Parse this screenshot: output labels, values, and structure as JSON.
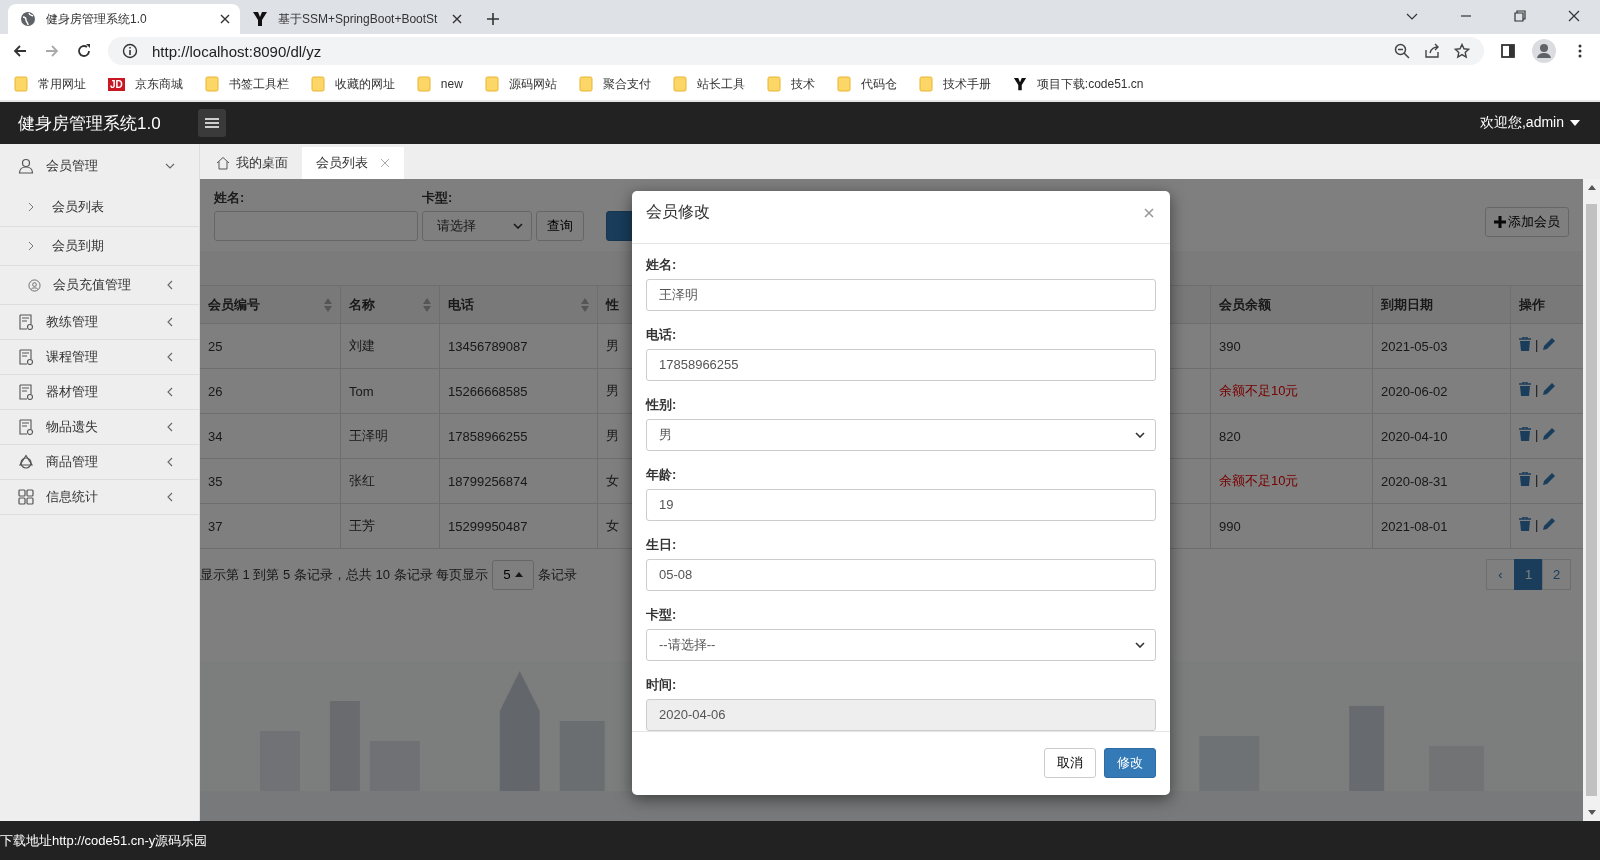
{
  "browser": {
    "tabs": [
      {
        "title": "健身房管理系统1.0",
        "selected": true
      },
      {
        "title": "基于SSM+SpringBoot+BootSt",
        "selected": false
      }
    ],
    "url": "http://localhost:8090/dl/yz",
    "bookmarks": [
      {
        "label": "常用网址",
        "kind": "folder"
      },
      {
        "label": "京东商城",
        "kind": "badge",
        "badge": "JD"
      },
      {
        "label": "书签工具栏",
        "kind": "folder"
      },
      {
        "label": "收藏的网址",
        "kind": "folder"
      },
      {
        "label": "new",
        "kind": "folder"
      },
      {
        "label": "源码网站",
        "kind": "folder"
      },
      {
        "label": "聚合支付",
        "kind": "folder"
      },
      {
        "label": "站长工具",
        "kind": "folder"
      },
      {
        "label": "技术",
        "kind": "folder"
      },
      {
        "label": "代码仓",
        "kind": "folder"
      },
      {
        "label": "技术手册",
        "kind": "folder"
      },
      {
        "label": "项目下载:code51.cn",
        "kind": "logo"
      }
    ]
  },
  "app": {
    "title": "健身房管理系统1.0",
    "user": "欢迎您,admin"
  },
  "sidebar": {
    "items": [
      {
        "label": "会员管理",
        "expanded": true,
        "children": [
          {
            "label": "会员列表",
            "kind": "link"
          },
          {
            "label": "会员到期",
            "kind": "link"
          },
          {
            "label": "会员充值管理",
            "kind": "group",
            "expanded": false
          }
        ]
      },
      {
        "label": "教练管理",
        "expanded": false
      },
      {
        "label": "课程管理",
        "expanded": false
      },
      {
        "label": "器材管理",
        "expanded": false
      },
      {
        "label": "物品遗失",
        "expanded": false
      },
      {
        "label": "商品管理",
        "expanded": false
      },
      {
        "label": "信息统计",
        "expanded": false
      }
    ]
  },
  "page_tabs": [
    {
      "label": "我的桌面",
      "selected": false,
      "closable": false
    },
    {
      "label": "会员列表",
      "selected": true,
      "closable": true
    }
  ],
  "search": {
    "name_label": "姓名:",
    "card_label": "卡型:",
    "card_value": "请选择",
    "query_button": "查询",
    "add_button": "添加会员"
  },
  "table": {
    "columns": [
      {
        "label": "会员编号",
        "sortable": true
      },
      {
        "label": "名称",
        "sortable": true
      },
      {
        "label": "电话",
        "sortable": true
      },
      {
        "label": "性",
        "sortable": false
      },
      {
        "label": "会员余额",
        "sortable": false
      },
      {
        "label": "到期日期",
        "sortable": false
      },
      {
        "label": "操作",
        "sortable": false
      }
    ],
    "rows": [
      {
        "cells": [
          "25",
          "刘建",
          "13456789087",
          "男",
          "390",
          "2021-05-03"
        ],
        "low_balance": false,
        "separator": "|"
      },
      {
        "cells": [
          "26",
          "Tom",
          "15266668585",
          "男",
          "余额不足10元",
          "2020-06-02"
        ],
        "low_balance": true,
        "separator": "|"
      },
      {
        "cells": [
          "34",
          "王泽明",
          "17858966255",
          "男",
          "820",
          "2020-04-10"
        ],
        "low_balance": false,
        "separator": "|"
      },
      {
        "cells": [
          "35",
          "张红",
          "18799256874",
          "女",
          "余额不足10元",
          "2020-08-31"
        ],
        "low_balance": true,
        "separator": "|"
      },
      {
        "cells": [
          "37",
          "王芳",
          "15299950487",
          "女",
          "990",
          "2021-08-01"
        ],
        "low_balance": false,
        "separator": "|"
      }
    ]
  },
  "pagination": {
    "info": "显示第 1 到第 5 条记录，总共 10 条记录 每页显示",
    "page_size": "5",
    "suffix": "条记录",
    "prev": "‹",
    "pages": [
      {
        "label": "1",
        "selected": true
      },
      {
        "label": "2",
        "selected": false
      }
    ]
  },
  "modal": {
    "title": "会员修改",
    "fields": [
      {
        "label": "姓名:",
        "kind": "input",
        "value": "王泽明"
      },
      {
        "label": "电话:",
        "kind": "input",
        "value": "17858966255"
      },
      {
        "label": "性别:",
        "kind": "select",
        "value": "男"
      },
      {
        "label": "年龄:",
        "kind": "input",
        "value": "19"
      },
      {
        "label": "生日:",
        "kind": "input",
        "value": "05-08"
      },
      {
        "label": "卡型:",
        "kind": "select",
        "value": "--请选择--"
      },
      {
        "label": "时间:",
        "kind": "readonly",
        "value": "2020-04-06"
      }
    ],
    "buttons": [
      {
        "label": "取消",
        "kind": "default"
      },
      {
        "label": "修改",
        "kind": "primary"
      }
    ]
  },
  "footer": "下载地址http://code51.cn-y源码乐园"
}
